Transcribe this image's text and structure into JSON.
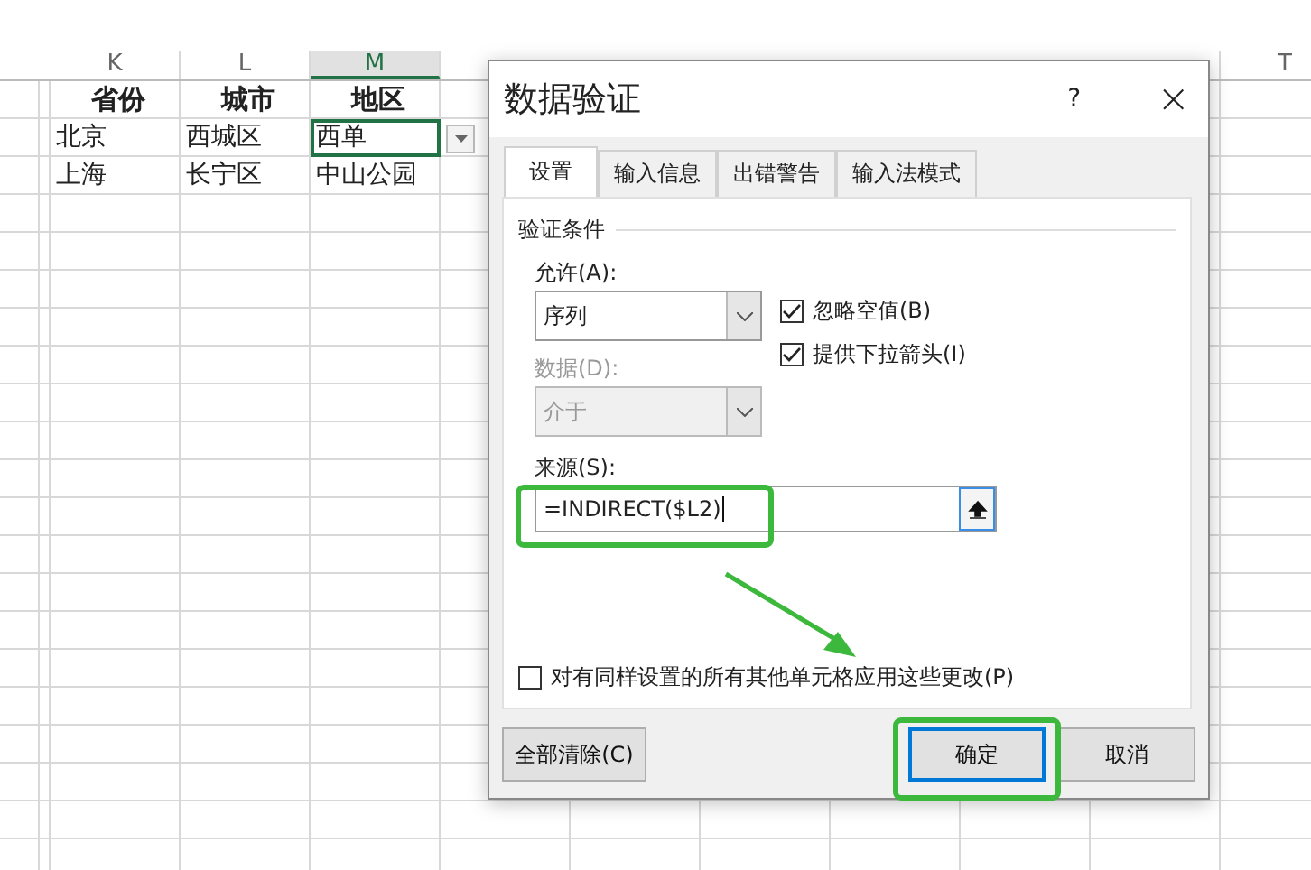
{
  "sheet": {
    "columns": [
      {
        "label": "K",
        "selected": false
      },
      {
        "label": "L",
        "selected": false
      },
      {
        "label": "M",
        "selected": true
      }
    ],
    "far_column": "T",
    "rows": [
      {
        "header": true,
        "cells": [
          {
            "text": "省份",
            "selected": false
          },
          {
            "text": "城市",
            "selected": false
          },
          {
            "text": "地区",
            "selected": false
          }
        ]
      },
      {
        "header": false,
        "cells": [
          {
            "text": "北京",
            "selected": false
          },
          {
            "text": "西城区",
            "selected": false
          },
          {
            "text": "西单",
            "selected": true
          }
        ]
      },
      {
        "header": false,
        "cells": [
          {
            "text": "上海",
            "selected": false
          },
          {
            "text": "长宁区",
            "selected": false
          },
          {
            "text": "中山公园",
            "selected": false
          }
        ]
      }
    ]
  },
  "dialog": {
    "title": "数据验证",
    "help": "?",
    "close": "×",
    "tabs": [
      {
        "label": "设置",
        "selected": true
      },
      {
        "label": "输入信息",
        "selected": false
      },
      {
        "label": "出错警告",
        "selected": false
      },
      {
        "label": "输入法模式",
        "selected": false
      }
    ],
    "group": "验证条件",
    "allow": {
      "label": "允许(A):",
      "value": "序列"
    },
    "checkboxes": [
      {
        "label": "忽略空值(B)",
        "checked": true
      },
      {
        "label": "提供下拉箭头(I)",
        "checked": true
      }
    ],
    "data": {
      "label": "数据(D):",
      "value": "介于",
      "disabled": true
    },
    "source": {
      "label": "来源(S):",
      "value": "=INDIRECT($L2)"
    },
    "apply_all": {
      "label": "对有同样设置的所有其他单元格应用这些更改(P)",
      "checked": false
    },
    "buttons": [
      {
        "label": "全部清除(C)",
        "kind": "left"
      },
      {
        "label": "确定",
        "kind": "default"
      },
      {
        "label": "取消",
        "kind": "normal"
      }
    ]
  }
}
